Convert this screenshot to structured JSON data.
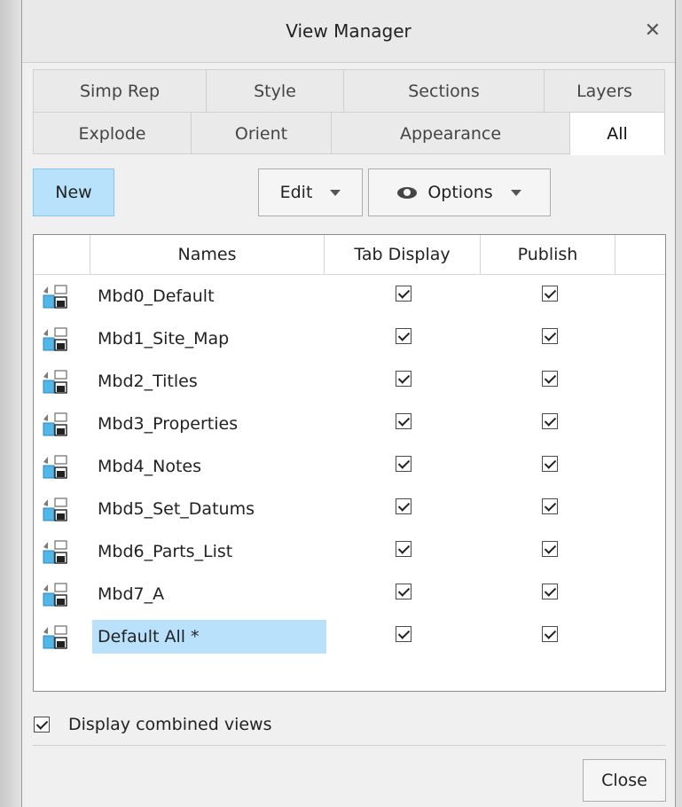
{
  "window": {
    "title": "View Manager",
    "close_glyph": "✕"
  },
  "tabs_row1": [
    "Simp Rep",
    "Style",
    "Sections",
    "Layers"
  ],
  "tabs_row2": [
    "Explode",
    "Orient",
    "Appearance",
    "All"
  ],
  "active_tab": "All",
  "toolbar": {
    "new_label": "New",
    "edit_label": "Edit",
    "options_label": "Options"
  },
  "columns": {
    "names": "Names",
    "tab_display": "Tab Display",
    "publish": "Publish"
  },
  "views": [
    {
      "name": "Mbd0_Default",
      "tab_display": true,
      "publish": true
    },
    {
      "name": "Mbd1_Site_Map",
      "tab_display": true,
      "publish": true
    },
    {
      "name": "Mbd2_Titles",
      "tab_display": true,
      "publish": true
    },
    {
      "name": "Mbd3_Properties",
      "tab_display": true,
      "publish": true
    },
    {
      "name": "Mbd4_Notes",
      "tab_display": true,
      "publish": true
    },
    {
      "name": "Mbd5_Set_Datums",
      "tab_display": true,
      "publish": true
    },
    {
      "name": "Mbd6_Parts_List",
      "tab_display": true,
      "publish": true
    },
    {
      "name": "Mbd7_A",
      "tab_display": true,
      "publish": true
    },
    {
      "name": "Default All *",
      "tab_display": true,
      "publish": true,
      "selected": true
    }
  ],
  "footer": {
    "display_combined_label": "Display combined views",
    "display_combined_checked": true,
    "close_label": "Close"
  },
  "colors": {
    "accent": "#b8e1fb",
    "background": "#f0f0f0"
  }
}
